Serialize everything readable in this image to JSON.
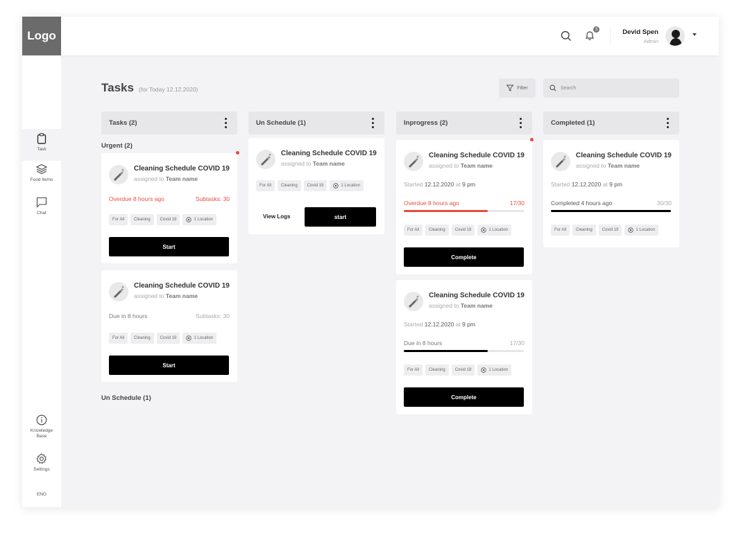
{
  "header": {
    "logo": "Logo",
    "notification_count": "3",
    "user_name": "Devid Spen",
    "user_role": "Admin"
  },
  "sidebar": {
    "items": [
      {
        "label": "Task"
      },
      {
        "label": "Food Items"
      },
      {
        "label": "Chat"
      },
      {
        "label": "Knowledge Base"
      },
      {
        "label": "Settings"
      },
      {
        "label": "ENG"
      }
    ]
  },
  "page": {
    "title": "Tasks",
    "subtitle": "(for Today 12.12.2020)",
    "filter_label": "Filter",
    "search_placeholder": "Search"
  },
  "columns": {
    "tasks": {
      "title": "Tasks (2)",
      "section_urgent": "Urgent (2)",
      "section_unschedule": "Un Schedule (1)",
      "cards": [
        {
          "title": "Cleaning Schedule COVID 19",
          "assigned_prefix": "assigned to ",
          "assignee": "Team name",
          "status": "Overdue 8 hours ago",
          "subtasks": "Subtasks: 30",
          "tags": [
            "For All",
            "Cleaning",
            "Covid 19",
            "1 Location"
          ],
          "button": "Start"
        },
        {
          "title": "Cleaning Schedule COVID 19",
          "assigned_prefix": "assigned to ",
          "assignee": "Team name",
          "status": "Due in 8 hours",
          "subtasks": "Subtasks: 30",
          "tags": [
            "For All",
            "Cleaning",
            "Covid 19",
            "1 Location"
          ],
          "button": "Start"
        }
      ]
    },
    "unschedule": {
      "title": "Un Schedule (1)",
      "cards": [
        {
          "title": "Cleaning Schedule COVID 19",
          "assigned_prefix": "assigned to ",
          "assignee": "Team name",
          "tags": [
            "For All",
            "Cleaning",
            "Covid 19",
            "1 Location"
          ],
          "link": "View Logs",
          "button": "start"
        }
      ]
    },
    "inprogress": {
      "title": "Inprogress (2)",
      "cards": [
        {
          "title": "Cleaning Schedule COVID 19",
          "assigned_prefix": "assigned to ",
          "assignee": "Team name",
          "started_prefix": "Started ",
          "started_date": "12.12.2020",
          "started_at": " at ",
          "started_time": "9 pm",
          "status": "Overdue 8 hours ago",
          "count": "17/30",
          "progress": 0.7,
          "tags": [
            "For All",
            "Cleaning",
            "Covid 19",
            "1 Location"
          ],
          "button": "Complete"
        },
        {
          "title": "Cleaning Schedule COVID 19",
          "assigned_prefix": "assigned to ",
          "assignee": "Team name",
          "started_prefix": "Started ",
          "started_date": "12.12.2020",
          "started_at": " at ",
          "started_time": "9 pm",
          "status": "Due in 8 hours",
          "count": "17/30",
          "progress": 0.7,
          "tags": [
            "For All",
            "Cleaning",
            "Covid 19",
            "1 Location"
          ],
          "button": "Complete"
        }
      ]
    },
    "completed": {
      "title": "Completed (1)",
      "cards": [
        {
          "title": "Cleaning Schedule COVID 19",
          "assigned_prefix": "assigned to ",
          "assignee": "Team name",
          "started_prefix": "Started ",
          "started_date": "12.12.2020",
          "started_at": " at ",
          "started_time": "9 pm",
          "status": "Completed 4 hours ago",
          "count": "30/30",
          "progress": 1.0,
          "tags": [
            "For All",
            "Cleaning",
            "Covid 19",
            "1 Location"
          ]
        }
      ]
    }
  },
  "colors": {
    "accent_red": "#e74c3c",
    "button_black": "#000000",
    "logo_bg": "#6b6b6b"
  }
}
